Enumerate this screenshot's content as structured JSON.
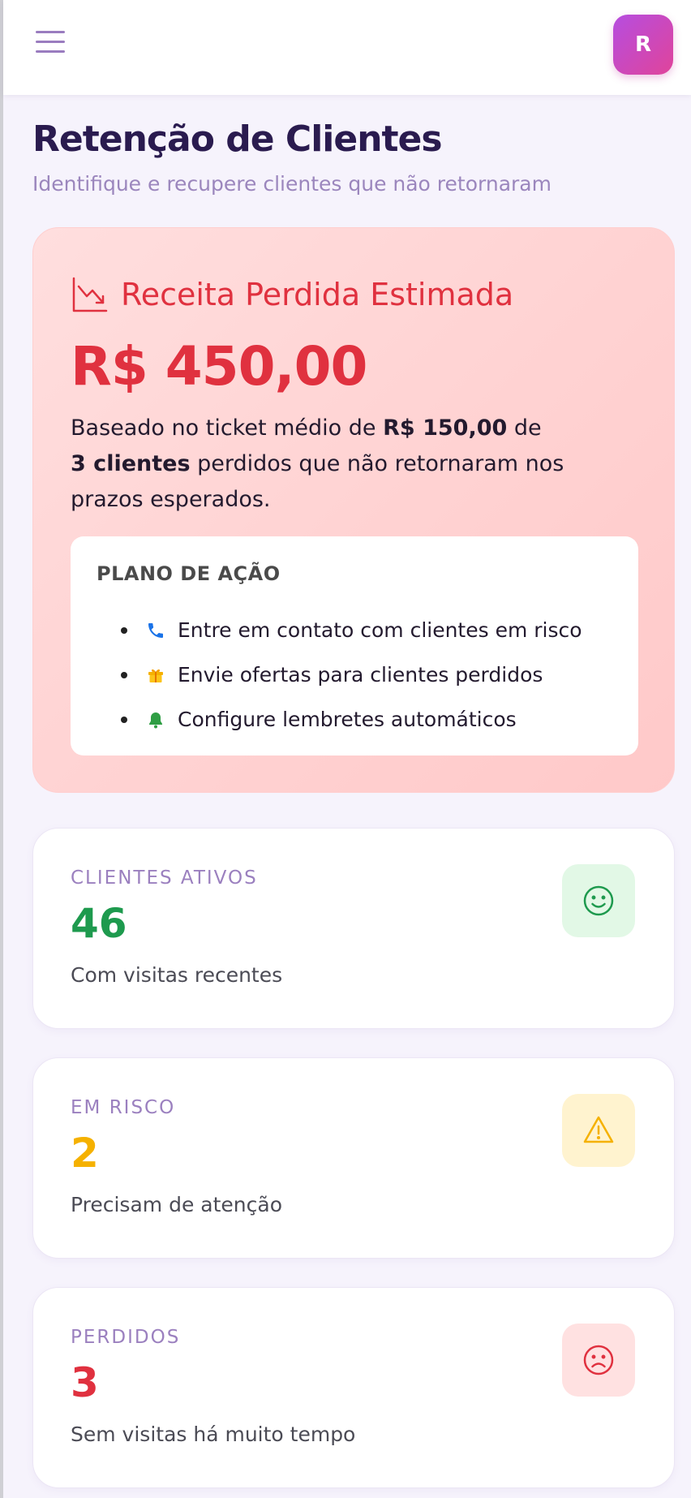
{
  "header": {
    "avatar_initial": "R",
    "menu_icon": "hamburger-menu-icon"
  },
  "page": {
    "title": "Retenção de Clientes",
    "subtitle": "Identifique e recupere clientes que não retornaram"
  },
  "revenue_card": {
    "icon": "trending-down-chart-icon",
    "title": "Receita Perdida Estimada",
    "amount": "R$ 450,00",
    "description": {
      "part1": "Baseado no ticket médio de ",
      "ticket": "R$ 150,00",
      "part2": " de ",
      "clients": "3 clientes",
      "part3": " perdidos que não retornaram nos prazos esperados."
    },
    "accent_color": "#e0313f",
    "action_plan": {
      "title": "PLANO DE AÇÃO",
      "items": [
        {
          "icon": "phone-icon",
          "label": "Entre em contato com clientes em risco"
        },
        {
          "icon": "gift-icon",
          "label": "Envie ofertas para clientes perdidos"
        },
        {
          "icon": "bell-icon",
          "label": "Configure lembretes automáticos"
        }
      ]
    }
  },
  "stats": [
    {
      "label": "CLIENTES ATIVOS",
      "value": "46",
      "description": "Com visitas recentes",
      "icon": "smile-icon",
      "color": "#1e9a4e",
      "icon_bg": "#e2f8e6"
    },
    {
      "label": "EM RISCO",
      "value": "2",
      "description": "Precisam de atenção",
      "icon": "warning-icon",
      "color": "#f5b100",
      "icon_bg": "#fff3cf"
    },
    {
      "label": "PERDIDOS",
      "value": "3",
      "description": "Sem visitas há muito tempo",
      "icon": "frown-icon",
      "color": "#e0313f",
      "icon_bg": "#ffe1e1"
    }
  ]
}
